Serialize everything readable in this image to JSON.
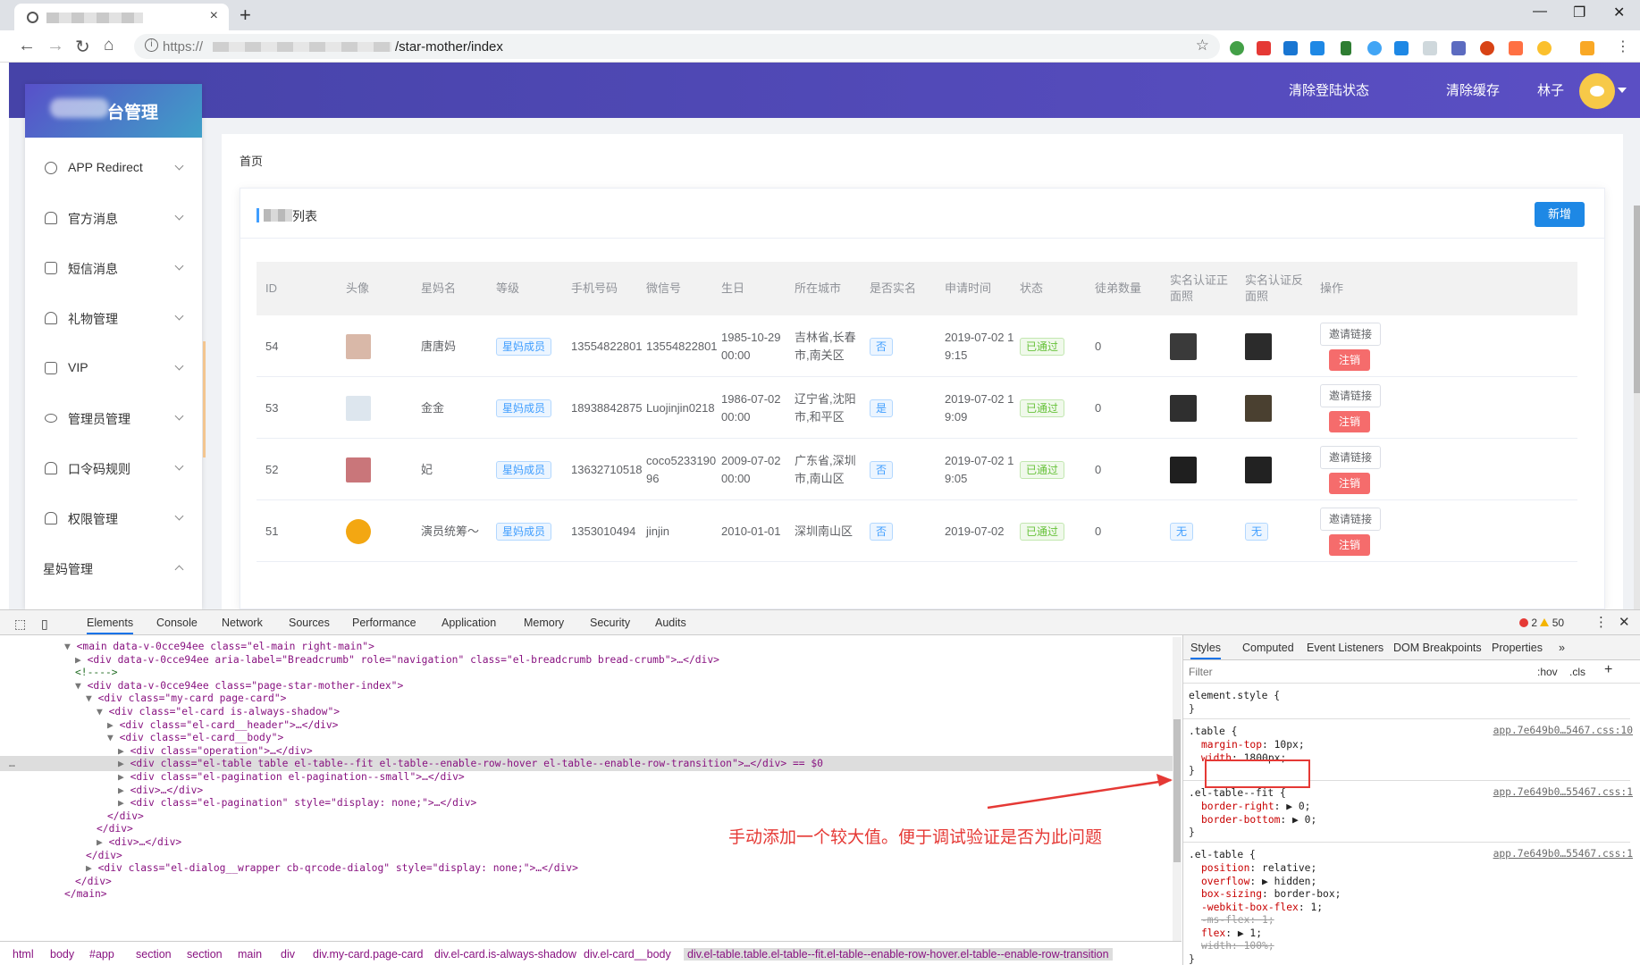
{
  "browser": {
    "url_scheme": "https://",
    "url_path": "/star-mother/index",
    "new_tab_label": "+",
    "close_tab_label": "×",
    "window_controls": [
      "—",
      "❐",
      "✕"
    ]
  },
  "header": {
    "brand_suffix": "台管理",
    "links": [
      "清除登陆状态",
      "清除缓存"
    ],
    "username": "林子"
  },
  "sidebar": {
    "items": [
      {
        "label": "APP Redirect",
        "icon": "share-icon"
      },
      {
        "label": "官方消息",
        "icon": "bell-icon"
      },
      {
        "label": "短信消息",
        "icon": "mail-icon"
      },
      {
        "label": "礼物管理",
        "icon": "headset-icon"
      },
      {
        "label": "VIP",
        "icon": "bag-icon"
      },
      {
        "label": "管理员管理",
        "icon": "eye-icon"
      },
      {
        "label": "口令码规则",
        "icon": "bell-icon"
      },
      {
        "label": "权限管理",
        "icon": "bell-icon"
      }
    ],
    "group_label": "星妈管理"
  },
  "main": {
    "breadcrumb": "首页",
    "card_title_suffix": "列表",
    "add_button": "新增",
    "columns": [
      "ID",
      "头像",
      "星妈名",
      "等级",
      "手机号码",
      "微信号",
      "生日",
      "所在城市",
      "是否实名",
      "申请时间",
      "状态",
      "徒弟数量",
      "实名认证正面照",
      "实名认证反面照",
      "操作"
    ],
    "rows": [
      {
        "id": "54",
        "name": "唐唐妈",
        "level": "星妈成员",
        "phone": "13554822801",
        "wechat": "13554822801",
        "birthday": "1985-10-29 00:00",
        "city": "吉林省,长春市,南关区",
        "realname": "否",
        "applied": "2019-07-02 19:15",
        "status": "已通过",
        "apprentices": "0",
        "avatar_color": "#d9b8a8",
        "id_front_color": "#3a3a3a",
        "id_back_color": "#2b2b2b"
      },
      {
        "id": "53",
        "name": "金金",
        "level": "星妈成员",
        "phone": "18938842875",
        "wechat": "Luojinjin0218",
        "birthday": "1986-07-02 00:00",
        "city": "辽宁省,沈阳市,和平区",
        "realname": "是",
        "applied": "2019-07-02 19:09",
        "status": "已通过",
        "apprentices": "0",
        "avatar_color": "#dde6ee",
        "id_front_color": "#2f2f2f",
        "id_back_color": "#4a4030"
      },
      {
        "id": "52",
        "name": "妃",
        "level": "星妈成员",
        "phone": "13632710518",
        "wechat": "coco523319096",
        "birthday": "2009-07-02 00:00",
        "city": "广东省,深圳市,南山区",
        "realname": "否",
        "applied": "2019-07-02 19:05",
        "status": "已通过",
        "apprentices": "0",
        "avatar_color": "#c9767a",
        "id_front_color": "#1f1f1f",
        "id_back_color": "#222222"
      },
      {
        "id": "51",
        "name": "演员统筹～",
        "level": "星妈成员",
        "phone": "1353010494",
        "wechat": "jinjin",
        "birthday": "2010-01-01",
        "city": "深圳南山区",
        "realname": "否",
        "applied": "2019-07-02",
        "status": "已通过",
        "apprentices": "0",
        "avatar_color": "#f3a712",
        "id_front_color": "#ecf5ff",
        "id_back_color": "#ecf5ff",
        "front_text": "无",
        "back_text": "无"
      }
    ],
    "op_invite": "邀请链接",
    "op_cancel": "注销"
  },
  "devtools": {
    "tabs": [
      "Elements",
      "Console",
      "Network",
      "Sources",
      "Performance",
      "Application",
      "Memory",
      "Security",
      "Audits"
    ],
    "errors": "2",
    "warnings": "50",
    "more_tabs": "»",
    "elements_lines": [
      {
        "indent": 5,
        "arrow": "▼",
        "html": "<main data-v-0cce94ee class=\"el-main right-main\">"
      },
      {
        "indent": 6,
        "arrow": "▶",
        "html": "<div data-v-0cce94ee aria-label=\"Breadcrumb\" role=\"navigation\" class=\"el-breadcrumb bread-crumb\">…</div>"
      },
      {
        "indent": 6,
        "arrow": "",
        "html": "<!---->"
      },
      {
        "indent": 6,
        "arrow": "▼",
        "html": "<div data-v-0cce94ee class=\"page-star-mother-index\">"
      },
      {
        "indent": 7,
        "arrow": "▼",
        "html": "<div class=\"my-card page-card\">"
      },
      {
        "indent": 8,
        "arrow": "▼",
        "html": "<div class=\"el-card is-always-shadow\">"
      },
      {
        "indent": 9,
        "arrow": "▶",
        "html": "<div class=\"el-card__header\">…</div>"
      },
      {
        "indent": 9,
        "arrow": "▼",
        "html": "<div class=\"el-card__body\">"
      },
      {
        "indent": 10,
        "arrow": "▶",
        "html": "<div class=\"operation\">…</div>"
      },
      {
        "indent": 10,
        "arrow": "▶",
        "html": "<div class=\"el-table table el-table--fit el-table--enable-row-hover el-table--enable-row-transition\">…</div> == $0"
      },
      {
        "indent": 10,
        "arrow": "▶",
        "html": "<div class=\"el-pagination el-pagination--small\">…</div>"
      },
      {
        "indent": 10,
        "arrow": "▶",
        "html": "<div>…</div>"
      },
      {
        "indent": 10,
        "arrow": "▶",
        "html": "<div class=\"el-pagination\" style=\"display: none;\">…</div>"
      },
      {
        "indent": 9,
        "arrow": "",
        "html": "</div>"
      },
      {
        "indent": 8,
        "arrow": "",
        "html": "</div>"
      },
      {
        "indent": 8,
        "arrow": "▶",
        "html": "<div>…</div>"
      },
      {
        "indent": 7,
        "arrow": "",
        "html": "</div>"
      },
      {
        "indent": 7,
        "arrow": "▶",
        "html": "<div class=\"el-dialog__wrapper cb-qrcode-dialog\" style=\"display: none;\">…</div>"
      },
      {
        "indent": 6,
        "arrow": "",
        "html": "</div>"
      },
      {
        "indent": 5,
        "arrow": "",
        "html": "</main>"
      }
    ],
    "breadcrumbs": [
      "html",
      "body",
      "#app",
      "section",
      "section",
      "main",
      "div",
      "div.my-card.page-card",
      "div.el-card.is-always-shadow",
      "div.el-card__body",
      "div.el-table.table.el-table--fit.el-table--enable-row-hover.el-table--enable-row-transition"
    ],
    "styles_tabs": [
      "Styles",
      "Computed",
      "Event Listeners",
      "DOM Breakpoints",
      "Properties"
    ],
    "filter_placeholder": "Filter",
    "hov": ":hov",
    "cls": ".cls",
    "rules": [
      {
        "selector": "element.style {",
        "source": "",
        "props": []
      },
      {
        "selector": ".table {",
        "source": "app.7e649b0…5467.css:10",
        "props": [
          {
            "p": "margin-top",
            "v": "10px"
          },
          {
            "p": "width",
            "v": "1800px"
          }
        ]
      },
      {
        "selector": ".el-table--fit {",
        "source": "app.7e649b0…55467.css:1",
        "props": [
          {
            "p": "border-right",
            "v": "▶ 0"
          },
          {
            "p": "border-bottom",
            "v": "▶ 0"
          }
        ]
      },
      {
        "selector": ".el-table {",
        "source": "app.7e649b0…55467.css:1",
        "props": [
          {
            "p": "position",
            "v": "relative"
          },
          {
            "p": "overflow",
            "v": "▶ hidden"
          },
          {
            "p": "box-sizing",
            "v": "border-box"
          },
          {
            "p": "-webkit-box-flex",
            "v": "1"
          },
          {
            "p": "-ms-flex",
            "v": "1",
            "struck": true
          },
          {
            "p": "flex",
            "v": "▶ 1"
          },
          {
            "p": "width",
            "v": "100%",
            "struck": true
          }
        ]
      }
    ],
    "annotation": "手动添加一个较大值。便于调试验证是否为此问题"
  }
}
